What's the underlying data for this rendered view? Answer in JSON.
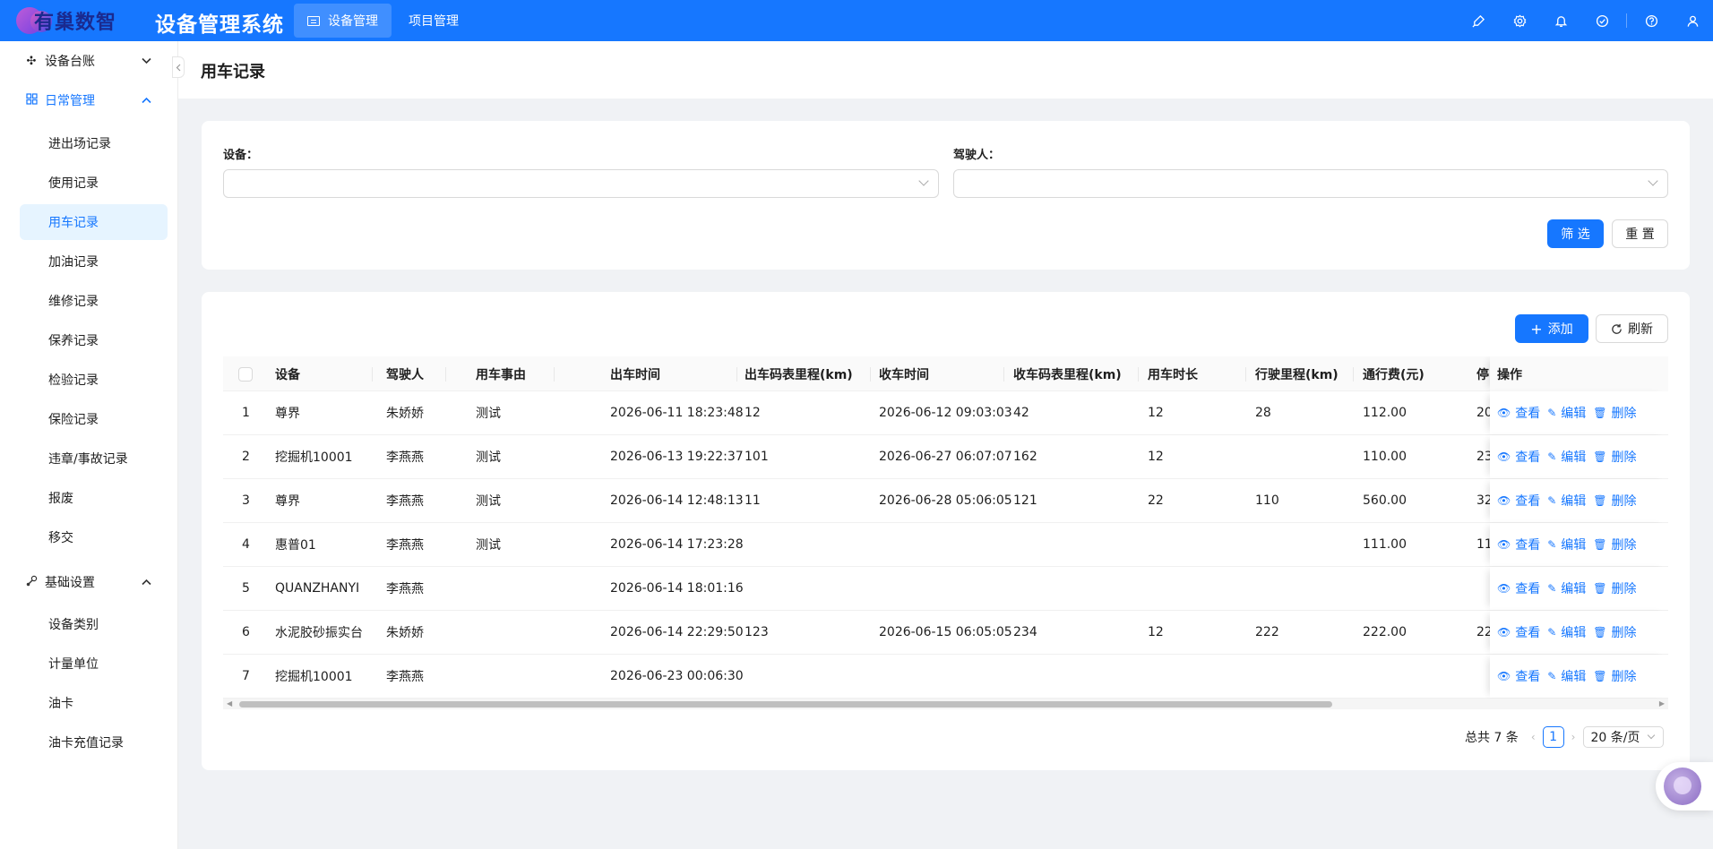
{
  "app": {
    "brand": "有巢数智",
    "title": "设备管理系统",
    "top_nav": [
      {
        "label": "设备管理",
        "active": true
      },
      {
        "label": "项目管理",
        "active": false
      }
    ],
    "header_icons": [
      "brush-icon",
      "gear-icon",
      "bell-icon",
      "check-circle-icon",
      "question-icon",
      "user-icon"
    ]
  },
  "sidebar": {
    "groups": [
      {
        "label": "设备台账",
        "icon": "apps-icon",
        "expanded": false
      },
      {
        "label": "日常管理",
        "icon": "grid-icon",
        "expanded": true
      },
      {
        "label": "基础设置",
        "icon": "tools-icon",
        "expanded": true
      }
    ],
    "daily_items": [
      "进出场记录",
      "使用记录",
      "用车记录",
      "加油记录",
      "维修记录",
      "保养记录",
      "检验记录",
      "保险记录",
      "违章/事故记录",
      "报废",
      "移交"
    ],
    "basic_items": [
      "设备类别",
      "计量单位",
      "油卡",
      "油卡充值记录"
    ],
    "active_item": "用车记录"
  },
  "page": {
    "title": "用车记录"
  },
  "filter": {
    "device_label": "设备：",
    "device_value": "",
    "driver_label": "驾驶人：",
    "driver_value": "",
    "filter_button": "筛 选",
    "reset_button": "重 置"
  },
  "toolbar": {
    "add_button": "添加",
    "refresh_button": "刷新"
  },
  "table": {
    "headers": [
      "设备",
      "驾驶人",
      "用车事由",
      "出车时间",
      "出车码表里程(km)",
      "收车时间",
      "收车码表里程(km)",
      "用车时长",
      "行驶里程(km)",
      "通行费(元)",
      "停",
      "操作"
    ],
    "actions": {
      "view": "查看",
      "edit": "编辑",
      "delete": "删除"
    },
    "rows": [
      {
        "no": "1",
        "device": "尊界",
        "driver": "朱娇娇",
        "reason": "测试",
        "out_time": "2026-06-11 18:23:48",
        "out_km": "12",
        "in_time": "2026-06-12 09:03:03",
        "in_km": "42",
        "duration": "12",
        "distance": "28",
        "toll": "112.00",
        "park": "20"
      },
      {
        "no": "2",
        "device": "挖掘机10001",
        "driver": "李燕燕",
        "reason": "测试",
        "out_time": "2026-06-13 19:22:37",
        "out_km": "101",
        "in_time": "2026-06-27 06:07:07",
        "in_km": "162",
        "duration": "12",
        "distance": "",
        "toll": "110.00",
        "park": "23"
      },
      {
        "no": "3",
        "device": "尊界",
        "driver": "李燕燕",
        "reason": "测试",
        "out_time": "2026-06-14 12:48:13",
        "out_km": "11",
        "in_time": "2026-06-28 05:06:05",
        "in_km": "121",
        "duration": "22",
        "distance": "110",
        "toll": "560.00",
        "park": "32"
      },
      {
        "no": "4",
        "device": "惠普01",
        "driver": "李燕燕",
        "reason": "测试",
        "out_time": "2026-06-14 17:23:28",
        "out_km": "",
        "in_time": "",
        "in_km": "",
        "duration": "",
        "distance": "",
        "toll": "111.00",
        "park": "11"
      },
      {
        "no": "5",
        "device": "QUANZHANYI",
        "driver": "李燕燕",
        "reason": "",
        "out_time": "2026-06-14 18:01:16",
        "out_km": "",
        "in_time": "",
        "in_km": "",
        "duration": "",
        "distance": "",
        "toll": "",
        "park": ""
      },
      {
        "no": "6",
        "device": "水泥胶砂振实台",
        "driver": "朱娇娇",
        "reason": "",
        "out_time": "2026-06-14 22:29:50",
        "out_km": "123",
        "in_time": "2026-06-15 06:05:05",
        "in_km": "234",
        "duration": "12",
        "distance": "222",
        "toll": "222.00",
        "park": "22"
      },
      {
        "no": "7",
        "device": "挖掘机10001",
        "driver": "李燕燕",
        "reason": "",
        "out_time": "2026-06-23 00:06:30",
        "out_km": "",
        "in_time": "",
        "in_km": "",
        "duration": "",
        "distance": "",
        "toll": "",
        "park": ""
      }
    ]
  },
  "pagination": {
    "total_text": "总共 7 条",
    "current_page": "1",
    "page_size": "20 条/页"
  },
  "colors": {
    "primary": "#1677ff",
    "header_bg": "#1677ff",
    "active_menu_bg": "#e6f4ff"
  }
}
